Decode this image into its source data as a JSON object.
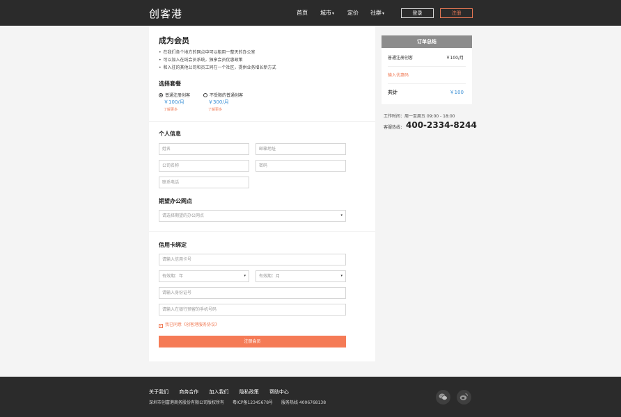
{
  "header": {
    "logo": "创客港",
    "nav": [
      {
        "label": "首页",
        "dropdown": false
      },
      {
        "label": "城市",
        "dropdown": true
      },
      {
        "label": "定价",
        "dropdown": false
      },
      {
        "label": "社群",
        "dropdown": true
      }
    ],
    "caret": "▾",
    "login_label": "登录",
    "register_label": "注册"
  },
  "main": {
    "title": "成为会员",
    "benefits": [
      "在我们各个地方的网点中可以租用一整天的办公室",
      "可以加入在线会员系统，独享会员优惠政策",
      "和入驻的其他公司和员工同在一个社区，提供业务增长新方式"
    ],
    "plan_section_title": "选择套餐",
    "plans": [
      {
        "name": "普通注册创客",
        "price": "￥100/月",
        "more": "了解更多",
        "selected": true
      },
      {
        "name": "不受限的普通创客",
        "price": "￥300/月",
        "more": "了解更多",
        "selected": false
      }
    ],
    "personal_title": "个人信息",
    "personal_fields": {
      "name": "姓名",
      "email": "邮箱地址",
      "company": "公司名称",
      "password": "密码",
      "phone": "联系电话"
    },
    "office_title": "期望办公网点",
    "office_select": "请选择期望的办公网点",
    "card_title": "信用卡绑定",
    "card_fields": {
      "card_number": "请输入信用卡号",
      "expiry_year": "有效期：年",
      "expiry_month": "有效期：月",
      "id_number": "请输入身份证号",
      "bank_phone": "请输入在银行预留的手机号码"
    },
    "agree_text": "我已同意《创客港服务协议》",
    "agree_check": "✓",
    "submit_label": "注册会员"
  },
  "summary": {
    "title": "订单总结",
    "item_name": "普通注册创客",
    "item_price": "￥100/月",
    "coupon_label": "输入优惠码",
    "total_label": "共计",
    "total_value": "￥100",
    "hours": "工作时间：周一至周五 09:00 - 18:00",
    "hotline_label": "客服热线：",
    "hotline": "400-2334-8244"
  },
  "footer": {
    "links": [
      "关于我们",
      "商务合作",
      "加入我们",
      "隐私政策",
      "帮助中心"
    ],
    "copyright": "深圳市创富港商务股份有限公司版权所有",
    "icp": "粤ICP备12345678号",
    "service_hotline": "服务热线 4006768138",
    "social": [
      "wechat-icon",
      "weibo-icon"
    ]
  },
  "colors": {
    "accent": "#f57b56",
    "price_blue": "#3a8fd5",
    "header_bg": "#2b2b2b",
    "summary_head": "#8c8c8c"
  }
}
